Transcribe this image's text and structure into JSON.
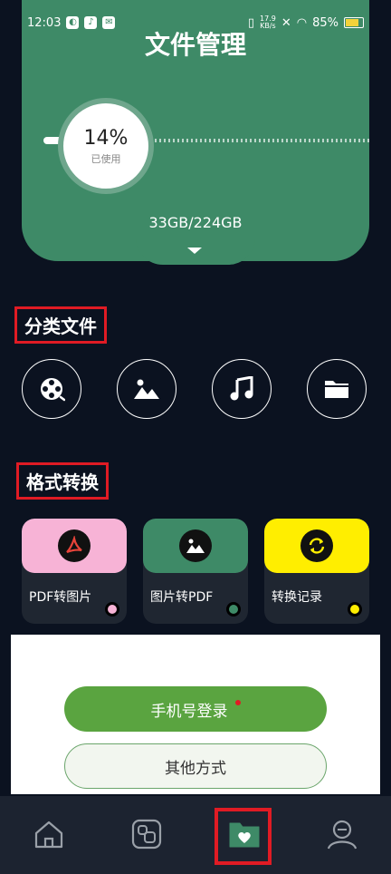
{
  "status_bar": {
    "time": "12:03",
    "net_speed_value": "17.9",
    "net_speed_unit": "KB/s",
    "battery": "85%"
  },
  "header": {
    "title": "文件管理",
    "usage_percent": "14%",
    "usage_label": "已使用",
    "storage": "33GB/224GB",
    "used_fraction": 0.14
  },
  "categories": {
    "title": "分类文件",
    "items": [
      {
        "icon": "video-icon"
      },
      {
        "icon": "image-icon"
      },
      {
        "icon": "music-icon"
      },
      {
        "icon": "folder-icon"
      }
    ]
  },
  "conversion": {
    "title": "格式转换",
    "items": [
      {
        "label": "PDF转图片",
        "color": "#f7b3d6",
        "icon": "pdf-icon"
      },
      {
        "label": "图片转PDF",
        "color": "#3e8a67",
        "icon": "image-icon"
      },
      {
        "label": "转换记录",
        "color": "#ffee00",
        "icon": "refresh-icon"
      }
    ]
  },
  "login": {
    "primary": "手机号登录",
    "secondary": "其他方式"
  },
  "nav": [
    {
      "icon": "home-icon"
    },
    {
      "icon": "apps-icon"
    },
    {
      "icon": "file-heart-icon"
    },
    {
      "icon": "profile-icon"
    }
  ],
  "colors": {
    "accent": "#3e8a67",
    "background": "#0b1220",
    "highlight_frame": "#e01b24"
  }
}
